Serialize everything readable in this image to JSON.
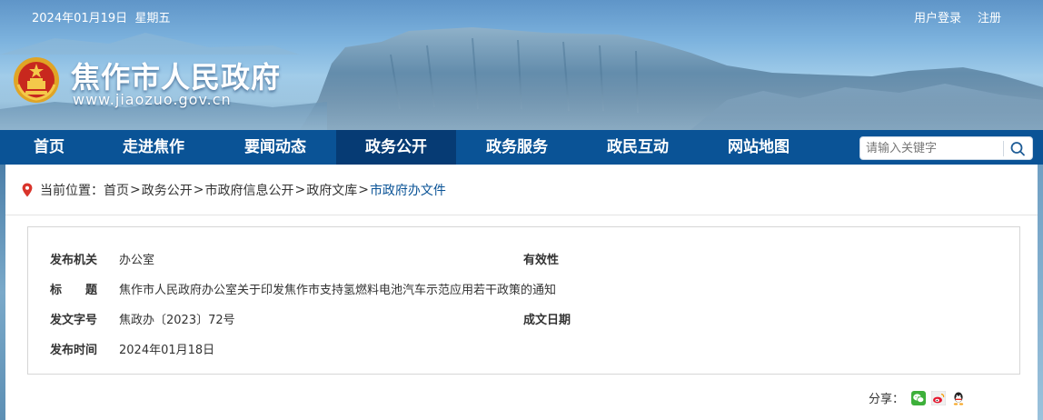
{
  "topbar": {
    "date": "2024年01月19日",
    "weekday": "星期五",
    "login": "用户登录",
    "register": "注册"
  },
  "header": {
    "site_title": "焦作市人民政府",
    "site_url": "www.jiaozuo.gov.cn"
  },
  "nav": {
    "items": [
      "首页",
      "走进焦作",
      "要闻动态",
      "政务公开",
      "政务服务",
      "政民互动",
      "网站地图"
    ],
    "active": "政务公开",
    "search_placeholder": "请输入关键字"
  },
  "breadcrumb": {
    "prefix": "当前位置：",
    "items": [
      "首页",
      "政务公开",
      "市政府信息公开",
      "政府文库",
      "市政府办文件"
    ],
    "separator": ">"
  },
  "info": {
    "issuer_label": "发布机关",
    "issuer_value": "办公室",
    "validity_label": "有效性",
    "title_label": "标　　题",
    "title_value": "焦作市人民政府办公室关于印发焦作市支持氢燃料电池汽车示范应用若干政策的通知",
    "doc_no_label": "发文字号",
    "doc_no_value": "焦政办〔2023〕72号",
    "date_label": "成文日期",
    "publish_label": "发布时间",
    "publish_value": "2024年01月18日"
  },
  "share": {
    "label": "分享：",
    "icons": [
      "wechat-icon",
      "weibo-icon",
      "qq-icon"
    ]
  },
  "colors": {
    "nav_bg": "#0a5396",
    "nav_active_bg": "#063b74",
    "link_current": "#0a5396",
    "pin_red": "#d9342b"
  }
}
